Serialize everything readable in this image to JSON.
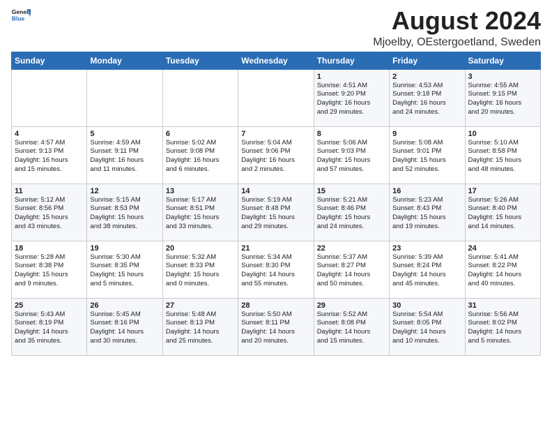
{
  "header": {
    "logo_line1": "General",
    "logo_line2": "Blue",
    "month_year": "August 2024",
    "location": "Mjoelby, OEstergoetland, Sweden"
  },
  "weekdays": [
    "Sunday",
    "Monday",
    "Tuesday",
    "Wednesday",
    "Thursday",
    "Friday",
    "Saturday"
  ],
  "weeks": [
    [
      {
        "day": "",
        "info": ""
      },
      {
        "day": "",
        "info": ""
      },
      {
        "day": "",
        "info": ""
      },
      {
        "day": "",
        "info": ""
      },
      {
        "day": "1",
        "info": "Sunrise: 4:51 AM\nSunset: 9:20 PM\nDaylight: 16 hours\nand 29 minutes."
      },
      {
        "day": "2",
        "info": "Sunrise: 4:53 AM\nSunset: 9:18 PM\nDaylight: 16 hours\nand 24 minutes."
      },
      {
        "day": "3",
        "info": "Sunrise: 4:55 AM\nSunset: 9:15 PM\nDaylight: 16 hours\nand 20 minutes."
      }
    ],
    [
      {
        "day": "4",
        "info": "Sunrise: 4:57 AM\nSunset: 9:13 PM\nDaylight: 16 hours\nand 15 minutes."
      },
      {
        "day": "5",
        "info": "Sunrise: 4:59 AM\nSunset: 9:11 PM\nDaylight: 16 hours\nand 11 minutes."
      },
      {
        "day": "6",
        "info": "Sunrise: 5:02 AM\nSunset: 9:08 PM\nDaylight: 16 hours\nand 6 minutes."
      },
      {
        "day": "7",
        "info": "Sunrise: 5:04 AM\nSunset: 9:06 PM\nDaylight: 16 hours\nand 2 minutes."
      },
      {
        "day": "8",
        "info": "Sunrise: 5:06 AM\nSunset: 9:03 PM\nDaylight: 15 hours\nand 57 minutes."
      },
      {
        "day": "9",
        "info": "Sunrise: 5:08 AM\nSunset: 9:01 PM\nDaylight: 15 hours\nand 52 minutes."
      },
      {
        "day": "10",
        "info": "Sunrise: 5:10 AM\nSunset: 8:58 PM\nDaylight: 15 hours\nand 48 minutes."
      }
    ],
    [
      {
        "day": "11",
        "info": "Sunrise: 5:12 AM\nSunset: 8:56 PM\nDaylight: 15 hours\nand 43 minutes."
      },
      {
        "day": "12",
        "info": "Sunrise: 5:15 AM\nSunset: 8:53 PM\nDaylight: 15 hours\nand 38 minutes."
      },
      {
        "day": "13",
        "info": "Sunrise: 5:17 AM\nSunset: 8:51 PM\nDaylight: 15 hours\nand 33 minutes."
      },
      {
        "day": "14",
        "info": "Sunrise: 5:19 AM\nSunset: 8:48 PM\nDaylight: 15 hours\nand 29 minutes."
      },
      {
        "day": "15",
        "info": "Sunrise: 5:21 AM\nSunset: 8:46 PM\nDaylight: 15 hours\nand 24 minutes."
      },
      {
        "day": "16",
        "info": "Sunrise: 5:23 AM\nSunset: 8:43 PM\nDaylight: 15 hours\nand 19 minutes."
      },
      {
        "day": "17",
        "info": "Sunrise: 5:26 AM\nSunset: 8:40 PM\nDaylight: 15 hours\nand 14 minutes."
      }
    ],
    [
      {
        "day": "18",
        "info": "Sunrise: 5:28 AM\nSunset: 8:38 PM\nDaylight: 15 hours\nand 9 minutes."
      },
      {
        "day": "19",
        "info": "Sunrise: 5:30 AM\nSunset: 8:35 PM\nDaylight: 15 hours\nand 5 minutes."
      },
      {
        "day": "20",
        "info": "Sunrise: 5:32 AM\nSunset: 8:33 PM\nDaylight: 15 hours\nand 0 minutes."
      },
      {
        "day": "21",
        "info": "Sunrise: 5:34 AM\nSunset: 8:30 PM\nDaylight: 14 hours\nand 55 minutes."
      },
      {
        "day": "22",
        "info": "Sunrise: 5:37 AM\nSunset: 8:27 PM\nDaylight: 14 hours\nand 50 minutes."
      },
      {
        "day": "23",
        "info": "Sunrise: 5:39 AM\nSunset: 8:24 PM\nDaylight: 14 hours\nand 45 minutes."
      },
      {
        "day": "24",
        "info": "Sunrise: 5:41 AM\nSunset: 8:22 PM\nDaylight: 14 hours\nand 40 minutes."
      }
    ],
    [
      {
        "day": "25",
        "info": "Sunrise: 5:43 AM\nSunset: 8:19 PM\nDaylight: 14 hours\nand 35 minutes."
      },
      {
        "day": "26",
        "info": "Sunrise: 5:45 AM\nSunset: 8:16 PM\nDaylight: 14 hours\nand 30 minutes."
      },
      {
        "day": "27",
        "info": "Sunrise: 5:48 AM\nSunset: 8:13 PM\nDaylight: 14 hours\nand 25 minutes."
      },
      {
        "day": "28",
        "info": "Sunrise: 5:50 AM\nSunset: 8:11 PM\nDaylight: 14 hours\nand 20 minutes."
      },
      {
        "day": "29",
        "info": "Sunrise: 5:52 AM\nSunset: 8:08 PM\nDaylight: 14 hours\nand 15 minutes."
      },
      {
        "day": "30",
        "info": "Sunrise: 5:54 AM\nSunset: 8:05 PM\nDaylight: 14 hours\nand 10 minutes."
      },
      {
        "day": "31",
        "info": "Sunrise: 5:56 AM\nSunset: 8:02 PM\nDaylight: 14 hours\nand 5 minutes."
      }
    ]
  ]
}
